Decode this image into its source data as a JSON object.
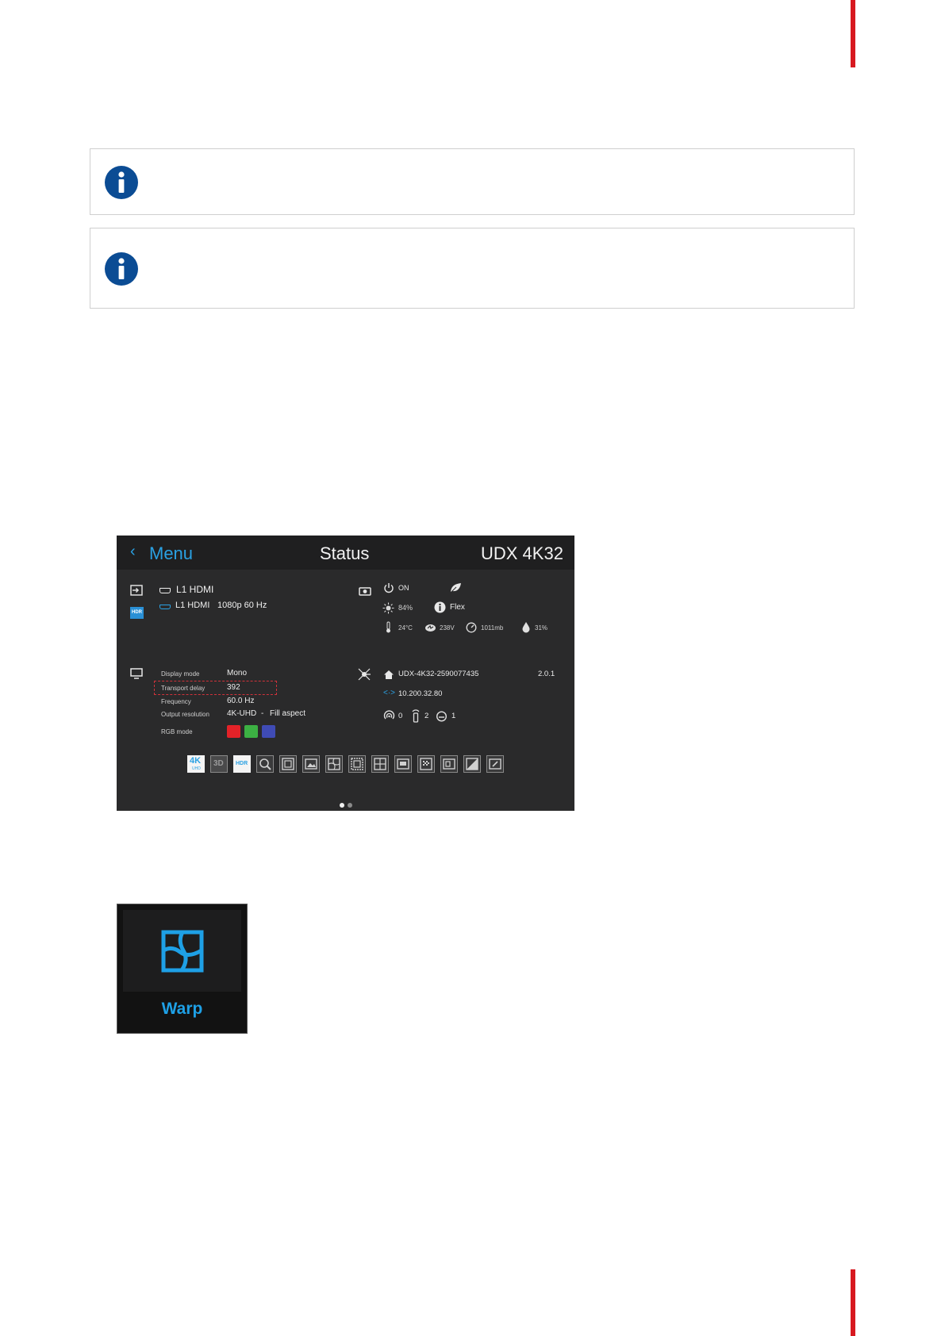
{
  "status_screen": {
    "header": {
      "back_label": "Menu",
      "title": "Status",
      "model": "UDX 4K32"
    },
    "source": {
      "input_name": "L1 HDMI",
      "signal_name": "L1 HDMI",
      "signal_format": "1080p 60 Hz",
      "hdr_badge": "HDR"
    },
    "projector": {
      "power_state": "ON",
      "brightness": "84%",
      "light_mode": "Flex",
      "temperature": "24°C",
      "voltage": "238V",
      "pressure": "1011mb",
      "humidity": "31%"
    },
    "display": {
      "rows": [
        {
          "label": "Display mode",
          "value": "Mono"
        },
        {
          "label": "Transport delay",
          "value": "392"
        },
        {
          "label": "Frequency",
          "value": "60.0 Hz"
        },
        {
          "label": "Output resolution",
          "value": "4K-UHD",
          "separator": "-",
          "extra": "Fill aspect"
        }
      ],
      "rgb_label": "RGB mode",
      "rgb_colors": [
        "#e32228",
        "#3cb043",
        "#3f4bb5"
      ]
    },
    "network": {
      "hostname": "UDX-4K32-2590077435",
      "version": "2.0.1",
      "ip": "10.200.32.80",
      "counts": {
        "wireless": "0",
        "remote": "2",
        "other": "1"
      }
    },
    "feature_tiles": {
      "tile_4k": "4K",
      "tile_4k_sub": "UHD",
      "tile_3d": "3D",
      "tile_hdr": "HDR"
    },
    "pager": {
      "pages": 2,
      "active": 1
    }
  },
  "warp_tile": {
    "label": "Warp",
    "accent": "#1ea0e6"
  },
  "colors": {
    "barco_red": "#d71920",
    "info_blue": "#0b4c94",
    "menu_blue": "#2aa1e3"
  }
}
